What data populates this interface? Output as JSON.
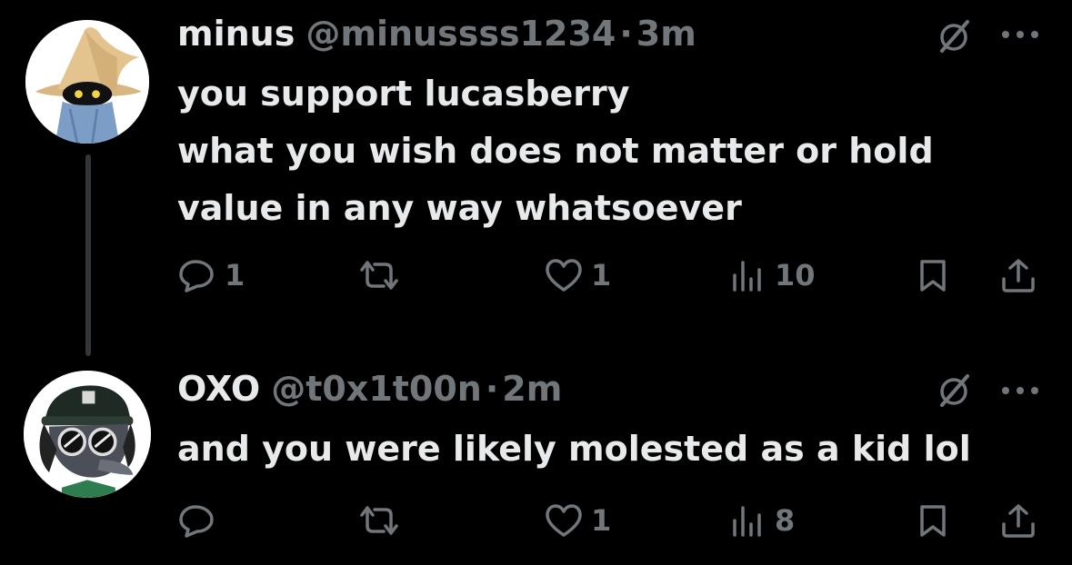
{
  "tweets": [
    {
      "name": "minus",
      "handle": "@minussss1234",
      "separator": "·",
      "time": "3m",
      "lines": [
        "you support lucasberry",
        "what you wish does not matter or hold",
        "value in any way whatsoever"
      ],
      "replies": "1",
      "reposts": "",
      "likes": "1",
      "views": "10"
    },
    {
      "name": "OXO",
      "handle": "@t0x1t00n",
      "separator": "·",
      "time": "2m",
      "lines": [
        "and you were likely molested as a kid lol"
      ],
      "replies": "",
      "reposts": "",
      "likes": "1",
      "views": "8"
    }
  ],
  "icons": {
    "reply": "reply-icon",
    "repost": "repost-icon",
    "like": "heart-icon",
    "views": "views-icon",
    "bookmark": "bookmark-icon",
    "share": "share-icon",
    "grok": "grok-icon",
    "more": "more-icon"
  },
  "colors": {
    "background": "#000000",
    "text": "#e7e9ea",
    "muted": "#71767b",
    "thread_line": "#333639"
  }
}
